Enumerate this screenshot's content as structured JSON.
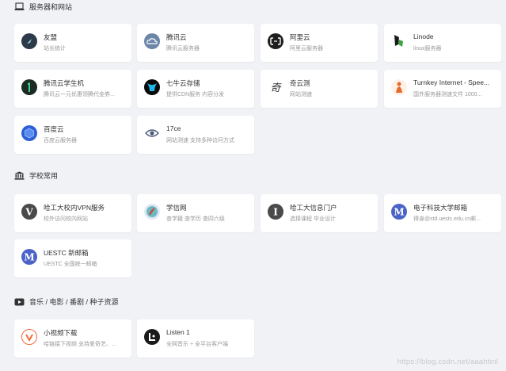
{
  "sections": [
    {
      "title": "服务器和网站",
      "icon": "laptop-icon",
      "items": [
        {
          "name": "友盟",
          "desc": "站长统计",
          "logo": "umeng-logo-icon"
        },
        {
          "name": "腾讯云",
          "desc": "腾讯云服务器",
          "logo": "tencent-cloud-logo-icon"
        },
        {
          "name": "阿里云",
          "desc": "阿里云服务器",
          "logo": "aliyun-logo-icon"
        },
        {
          "name": "Linode",
          "desc": "linux服务器",
          "logo": "linode-logo-icon"
        },
        {
          "name": "腾讯云学生机",
          "desc": "腾讯云一元优惠领腾代金券...",
          "logo": "tencent-student-logo-icon"
        },
        {
          "name": "七牛云存储",
          "desc": "提供CDN服务 内容分发",
          "logo": "qiniu-logo-icon"
        },
        {
          "name": "奇云测",
          "desc": "网站测速",
          "logo": "qiyunce-logo-icon"
        },
        {
          "name": "Turnkey Internet - Spee...",
          "desc": "国外服务器测速文件 1000...",
          "logo": "turnkey-logo-icon"
        },
        {
          "name": "百度云",
          "desc": "百度云服务器",
          "logo": "baidu-cloud-logo-icon"
        },
        {
          "name": "17ce",
          "desc": "网站测速 支持多种访问方式",
          "logo": "17ce-logo-icon"
        }
      ]
    },
    {
      "title": "学校常用",
      "icon": "bank-icon",
      "items": [
        {
          "name": "哈工大校内VPN服务",
          "desc": "校外访问校内网站",
          "logo": "hit-vpn-logo-icon"
        },
        {
          "name": "学信网",
          "desc": "查学籍 查学历 查四六级",
          "logo": "chsi-logo-icon"
        },
        {
          "name": "哈工大信息门户",
          "desc": "选择课程 毕业设计",
          "logo": "hit-portal-logo-icon"
        },
        {
          "name": "电子科技大学邮箱",
          "desc": "得身@std.uestc.edu.cn邮...",
          "logo": "uestc-mail-logo-icon"
        },
        {
          "name": "UESTC 新邮箱",
          "desc": "UESTC 全国统一邮箱",
          "logo": "uestc-new-mail-logo-icon"
        }
      ]
    },
    {
      "title": "音乐 / 电影 / 番剧 / 种子资源",
      "icon": "youtube-play-icon",
      "items": [
        {
          "name": "小视频下载",
          "desc": "哈链接下视频 支持爱奇艺、...",
          "logo": "video-download-logo-icon"
        },
        {
          "name": "Listen 1",
          "desc": "全网音乐 + 全平台客户端",
          "logo": "listen1-logo-icon"
        }
      ]
    }
  ],
  "watermark": "https://blog.csdn.net/aaahtml",
  "colors": {
    "background": "#f0f2f5",
    "card": "#ffffff",
    "title_text": "#333333",
    "desc_text": "#999999"
  }
}
